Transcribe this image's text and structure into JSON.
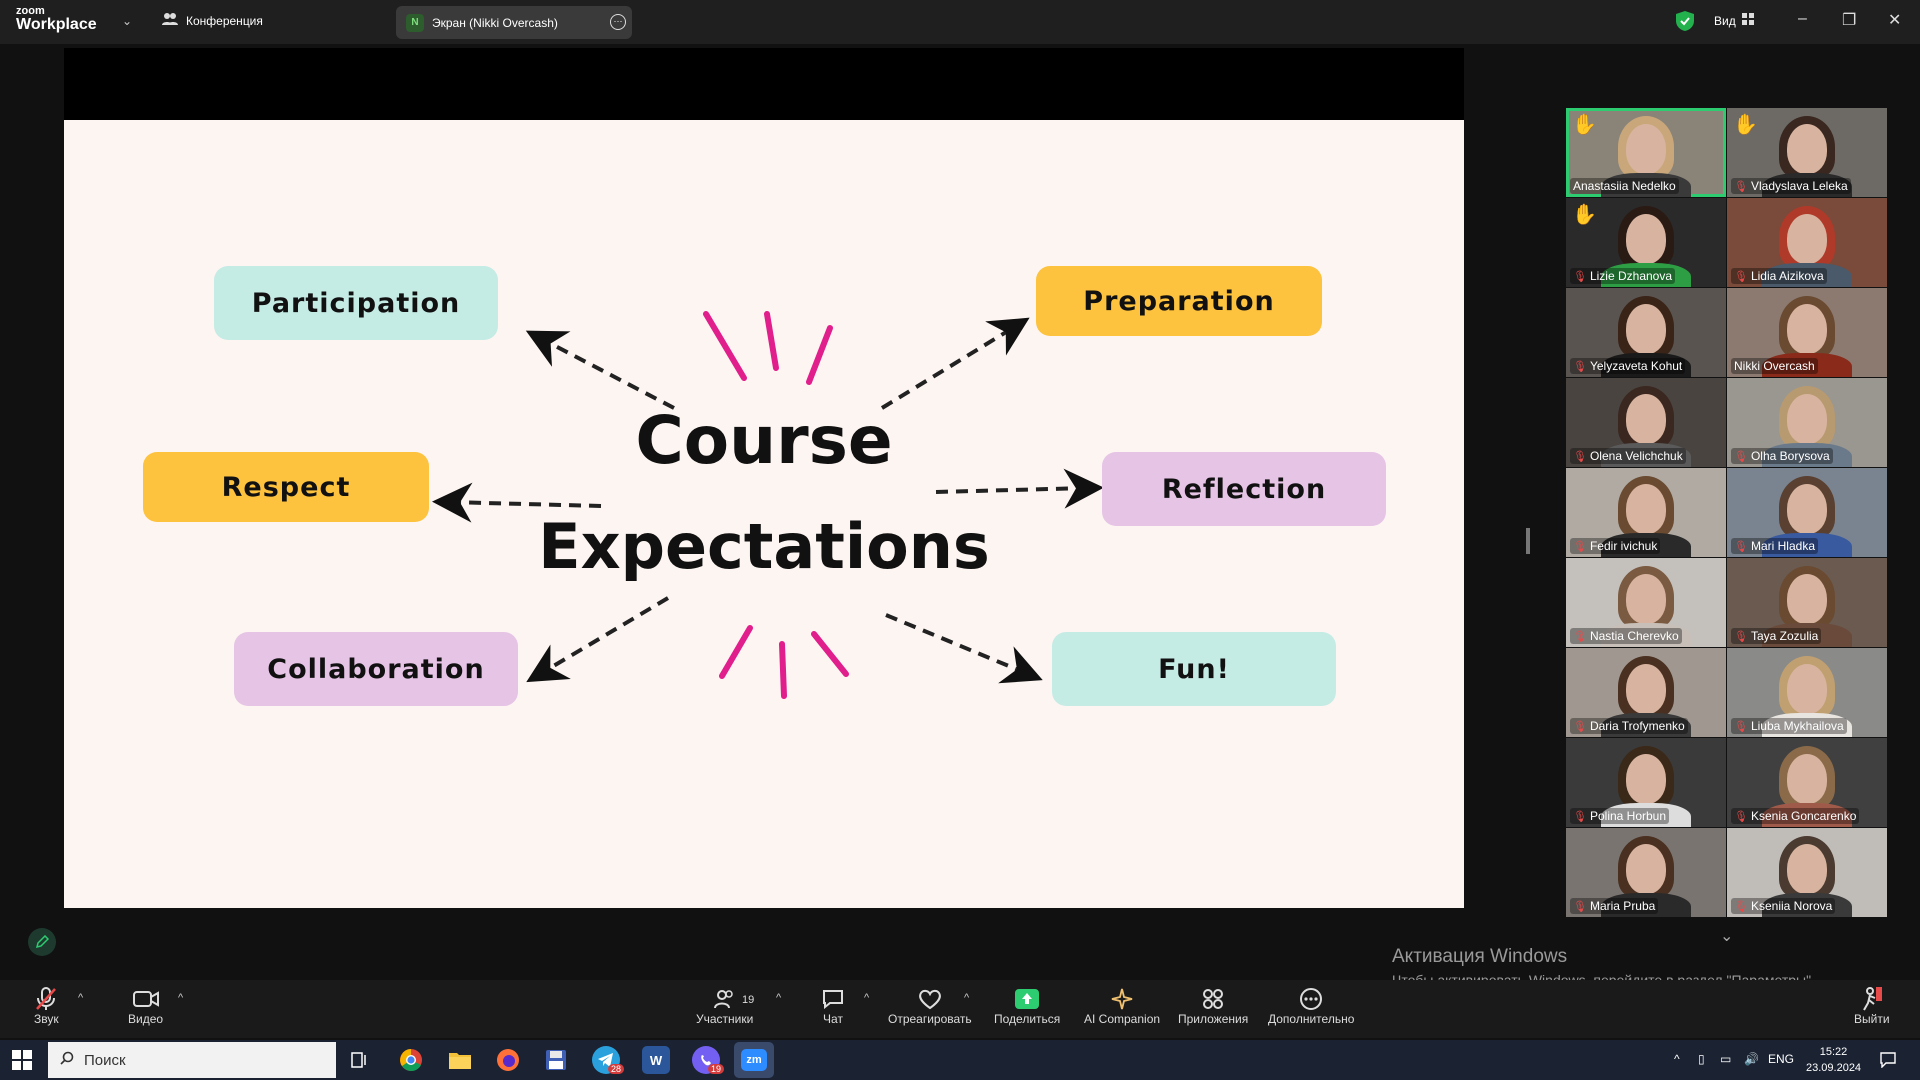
{
  "titlebar": {
    "logo_line1": "zoom",
    "logo_line2": "Workplace",
    "meeting_label": "Конференция",
    "share_initial": "N",
    "share_label": "Экран (Nikki Overcash)",
    "view_label": "Вид"
  },
  "slide": {
    "title_line1": "Course",
    "title_line2": "Expectations",
    "items": {
      "participation": "Participation",
      "preparation": "Preparation",
      "respect": "Respect",
      "reflection": "Reflection",
      "collaboration": "Collaboration",
      "fun": "Fun!"
    },
    "colors": {
      "teal": "#c5ebe5",
      "orange": "#fdc23e",
      "lilac": "#e6c4e6",
      "burst": "#e01e8c"
    }
  },
  "participants": [
    {
      "name": "Anastasiia Nedelko",
      "hand": true,
      "muted": false,
      "active": true
    },
    {
      "name": "Vladyslava Leleka",
      "hand": true,
      "muted": true
    },
    {
      "name": "Lizie Dzhanova",
      "hand": true,
      "muted": true
    },
    {
      "name": "Lidia Aizikova",
      "hand": false,
      "muted": true
    },
    {
      "name": "Yelyzaveta Kohut",
      "hand": false,
      "muted": true
    },
    {
      "name": "Nikki Overcash",
      "hand": false,
      "muted": false
    },
    {
      "name": "Olena Velichchuk",
      "hand": false,
      "muted": true
    },
    {
      "name": "Olha Borysova",
      "hand": false,
      "muted": true
    },
    {
      "name": "Fedir ivichuk",
      "hand": false,
      "muted": true
    },
    {
      "name": "Mari Hladka",
      "hand": false,
      "muted": true
    },
    {
      "name": "Nastia Cherevko",
      "hand": false,
      "muted": true
    },
    {
      "name": "Taya Zozulia",
      "hand": false,
      "muted": true
    },
    {
      "name": "Daria Trofymenko",
      "hand": false,
      "muted": true
    },
    {
      "name": "Liuba Mykhailova",
      "hand": false,
      "muted": true
    },
    {
      "name": "Polina Horbun",
      "hand": false,
      "muted": true
    },
    {
      "name": "Ksenia Goncarenko",
      "hand": false,
      "muted": true
    },
    {
      "name": "Maria Pruba",
      "hand": false,
      "muted": true
    },
    {
      "name": "Kseniia Norova",
      "hand": false,
      "muted": true
    }
  ],
  "toolbar": {
    "audio": "Звук",
    "video": "Видео",
    "participants": "Участники",
    "participants_count": "19",
    "chat": "Чат",
    "react": "Отреагировать",
    "share": "Поделиться",
    "ai": "AI Companion",
    "apps": "Приложения",
    "more": "Дополнительно",
    "leave": "Выйти"
  },
  "activation": {
    "title": "Активация Windows",
    "text": "Чтобы активировать Windows, перейдите в раздел \"Параметры\"."
  },
  "taskbar": {
    "search_placeholder": "Поиск",
    "telegram_badge": "28",
    "viber_badge": "19",
    "lang": "ENG",
    "time": "15:22",
    "date": "23.09.2024"
  }
}
